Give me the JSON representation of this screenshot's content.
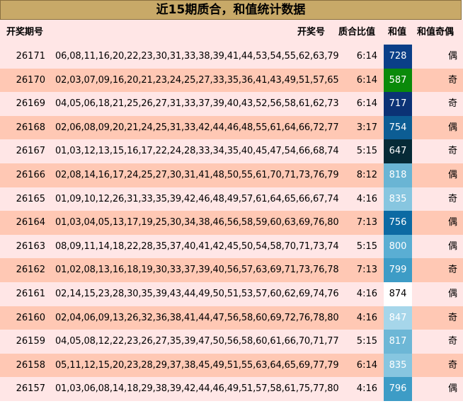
{
  "title": "近15期质合，和值统计数据",
  "headers": {
    "period": "开奖期号",
    "numbers": "开奖号",
    "ratio": "质合比值",
    "sum": "和值",
    "parity": "和值奇偶"
  },
  "rows": [
    {
      "period": "26171",
      "numbers": "06,08,11,16,20,22,23,30,31,33,38,39,41,44,53,54,55,62,63,79",
      "ratio": "6:14",
      "sum": "728",
      "sum_color": "#0a3f88",
      "parity": "偶"
    },
    {
      "period": "26170",
      "numbers": "02,03,07,09,16,20,21,23,24,25,27,33,35,36,41,43,49,51,57,65",
      "ratio": "6:14",
      "sum": "587",
      "sum_color": "#0a8a0a",
      "parity": "奇"
    },
    {
      "period": "26169",
      "numbers": "04,05,06,18,21,25,26,27,31,33,37,39,40,43,52,56,58,61,62,73",
      "ratio": "6:14",
      "sum": "717",
      "sum_color": "#0b3275",
      "parity": "奇"
    },
    {
      "period": "26168",
      "numbers": "02,06,08,09,20,21,24,25,31,33,42,44,46,48,55,61,64,66,72,77",
      "ratio": "3:17",
      "sum": "754",
      "sum_color": "#0c5d94",
      "parity": "偶"
    },
    {
      "period": "26167",
      "numbers": "01,03,12,13,15,16,17,22,24,28,33,34,35,40,45,47,54,66,68,74",
      "ratio": "5:15",
      "sum": "647",
      "sum_color": "#062a36",
      "parity": "奇"
    },
    {
      "period": "26166",
      "numbers": "02,08,14,16,17,24,25,27,30,31,41,48,50,55,61,70,71,73,76,79",
      "ratio": "8:12",
      "sum": "818",
      "sum_color": "#6ab5d4",
      "parity": "偶"
    },
    {
      "period": "26165",
      "numbers": "01,09,10,12,26,31,33,35,39,42,46,48,49,57,61,64,65,66,67,74",
      "ratio": "4:16",
      "sum": "835",
      "sum_color": "#87c6e0",
      "parity": "奇"
    },
    {
      "period": "26164",
      "numbers": "01,03,04,05,13,17,19,25,30,34,38,46,56,58,59,60,63,69,76,80",
      "ratio": "7:13",
      "sum": "756",
      "sum_color": "#0c6aa3",
      "parity": "偶"
    },
    {
      "period": "26163",
      "numbers": "08,09,11,14,18,22,28,35,37,40,41,42,45,50,54,58,70,71,73,74",
      "ratio": "5:15",
      "sum": "800",
      "sum_color": "#5aaed3",
      "parity": "偶"
    },
    {
      "period": "26162",
      "numbers": "01,02,08,13,16,18,19,30,33,37,39,40,56,57,63,69,71,73,76,78",
      "ratio": "7:13",
      "sum": "799",
      "sum_color": "#3d9cc6",
      "parity": "奇"
    },
    {
      "period": "26161",
      "numbers": "02,14,15,23,28,30,35,39,43,44,49,50,51,53,57,60,62,69,74,76",
      "ratio": "4:16",
      "sum": "874",
      "sum_color": "#ffffff",
      "sum_text_dark": true,
      "parity": "偶"
    },
    {
      "period": "26160",
      "numbers": "02,04,06,09,13,26,32,36,38,41,44,47,56,58,60,69,72,76,78,80",
      "ratio": "4:16",
      "sum": "847",
      "sum_color": "#a6d6ea",
      "parity": "奇"
    },
    {
      "period": "26159",
      "numbers": "04,05,08,12,22,23,26,27,35,39,47,50,56,58,60,61,66,70,71,77",
      "ratio": "5:15",
      "sum": "817",
      "sum_color": "#6db7d6",
      "parity": "奇"
    },
    {
      "period": "26158",
      "numbers": "05,11,12,15,20,23,28,29,37,38,45,49,51,55,63,64,65,69,77,79",
      "ratio": "6:14",
      "sum": "835",
      "sum_color": "#87c6e0",
      "parity": "奇"
    },
    {
      "period": "26157",
      "numbers": "01,03,06,08,14,18,29,38,39,42,44,46,49,51,57,58,61,75,77,80",
      "ratio": "4:16",
      "sum": "796",
      "sum_color": "#3d9cc6",
      "parity": "偶"
    }
  ]
}
